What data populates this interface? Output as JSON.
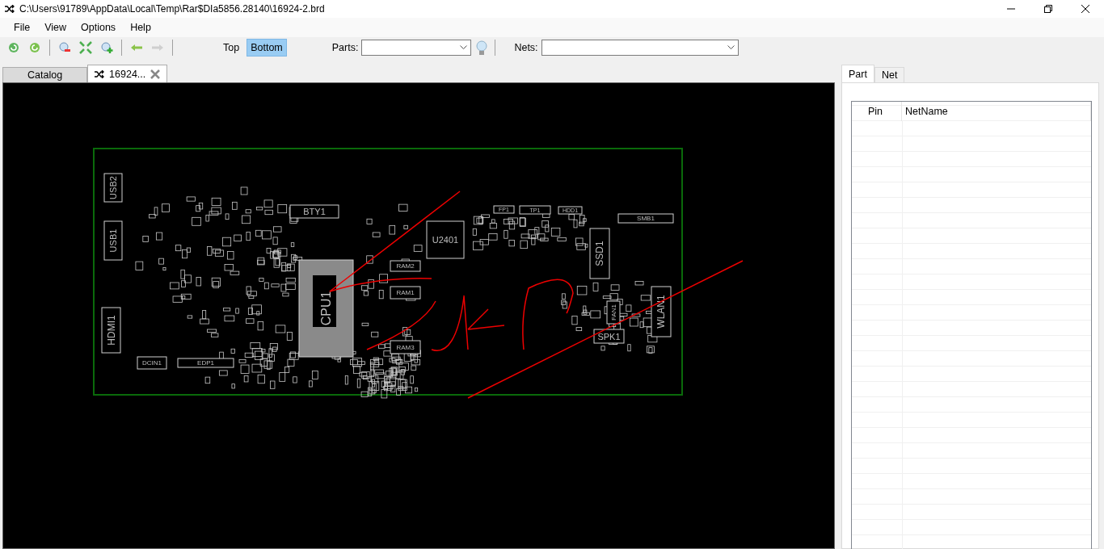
{
  "window": {
    "title": "C:\\Users\\91789\\AppData\\Local\\Temp\\Rar$DIa5856.28140\\16924-2.brd"
  },
  "menu": [
    "File",
    "View",
    "Options",
    "Help"
  ],
  "toolbar": {
    "buttons": [
      {
        "kind": "refresh",
        "disabled": false
      },
      {
        "kind": "rotate",
        "disabled": false
      },
      {
        "kind": "zoom-out",
        "disabled": false
      },
      {
        "kind": "fit",
        "disabled": false
      },
      {
        "kind": "zoom-in",
        "disabled": false
      },
      {
        "kind": "back",
        "disabled": false
      },
      {
        "kind": "forward",
        "disabled": true
      }
    ],
    "layers": [
      {
        "label": "Top",
        "selected": false
      },
      {
        "label": "Bottom",
        "selected": true
      }
    ],
    "parts": {
      "label": "Parts:"
    },
    "nets": {
      "label": "Nets:"
    }
  },
  "tabs": [
    {
      "label": "Catalog",
      "selected": false,
      "closable": false
    },
    {
      "label": "16924...",
      "selected": true,
      "closable": true
    }
  ],
  "board": {
    "components": [
      "USB2",
      "USB1",
      "HDMI1",
      "DCIN1",
      "EDP1",
      "BTY1",
      "CPU1",
      "U2401",
      "RAM2",
      "RAM1",
      "RAM3",
      "FP1",
      "TP1",
      "HDD1",
      "SMB1",
      "SSD1",
      "FAN1",
      "SPK1",
      "WLAN1"
    ]
  },
  "side_panel": {
    "tabs": [
      {
        "label": "Part",
        "selected": true
      },
      {
        "label": "Net",
        "selected": false
      }
    ],
    "columns": [
      "Pin",
      "NetName"
    ]
  }
}
